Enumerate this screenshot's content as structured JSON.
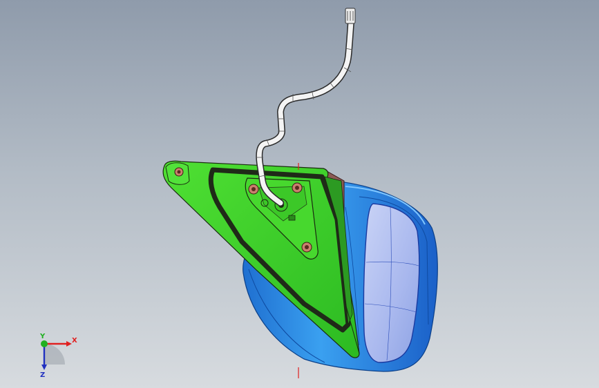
{
  "viewport": {
    "background_top": "#8f9bab",
    "background_bottom": "#d7dbdf"
  },
  "model": {
    "parts": [
      {
        "name": "mirror-housing",
        "color": "#2f8fe8"
      },
      {
        "name": "mirror-glass",
        "color": "#b9c6f2"
      },
      {
        "name": "mounting-base",
        "color": "#3fd02a"
      },
      {
        "name": "wire-harness",
        "color": "#f4f4f4"
      },
      {
        "name": "connector-plug",
        "color": "#e8e8e8"
      },
      {
        "name": "bolt",
        "color": "#d08a78"
      }
    ]
  },
  "axis_triad": {
    "x_label": "X",
    "y_label": "Y",
    "z_label": "Z",
    "x_color": "#e02020",
    "y_color": "#20b020",
    "z_color": "#2030c0"
  }
}
